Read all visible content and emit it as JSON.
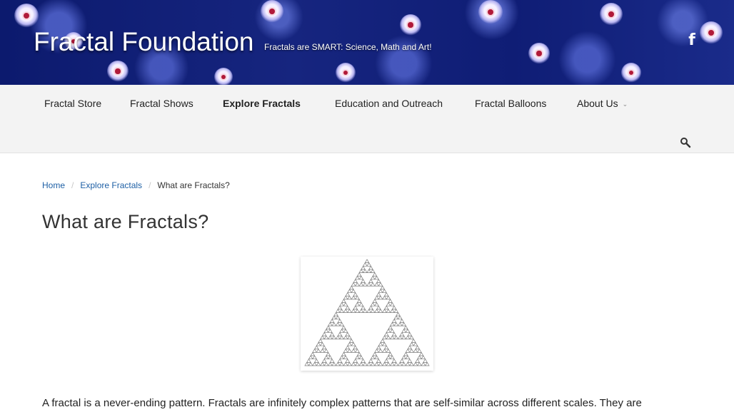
{
  "header": {
    "site_title": "Fractal Foundation",
    "tagline": "Fractals are SMART: Science, Math and Art!",
    "social_icon": "facebook-icon",
    "background_colors": [
      "#0c1a6e",
      "#1a2b8a"
    ]
  },
  "nav": {
    "items": [
      {
        "label": "Fractal Store"
      },
      {
        "label": "Fractal Shows"
      },
      {
        "label": "Explore Fractals",
        "active": true
      },
      {
        "label": "Education and Outreach"
      },
      {
        "label": "Fractal Balloons"
      },
      {
        "label": "About Us",
        "has_dropdown": true
      }
    ],
    "search_icon": "search-icon"
  },
  "breadcrumb": {
    "items": [
      "Home",
      "Explore Fractals"
    ],
    "current": "What are Fractals?",
    "link_color": "#1d5fa5"
  },
  "main": {
    "title": "What are Fractals?",
    "image": "sierpinski-triangle",
    "intro_text": "A fractal is a never-ending pattern. Fractals are infinitely complex patterns that are self-similar across different scales. They are"
  }
}
